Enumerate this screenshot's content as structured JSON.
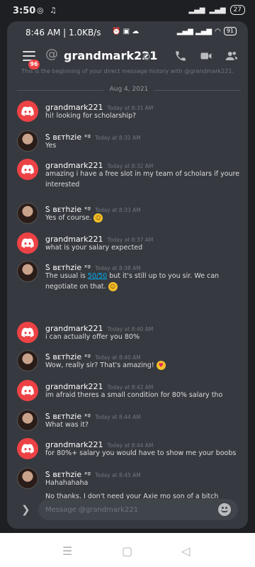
{
  "outer_status": {
    "time": "3:50",
    "battery": "27"
  },
  "inner_status": {
    "time": "8:46 AM | 1.0KB/s",
    "battery": "91"
  },
  "header": {
    "title": "grandmark221",
    "badge": "96",
    "at_symbol": "@"
  },
  "channel": {
    "beginning_text": "This is the beginning of your direct message history with @grandmark221.",
    "date_separator": "Aug 4, 2021"
  },
  "messages": [
    {
      "author": "grandmark221",
      "timestamp": "Today at 8:31 AM",
      "text": "hi! looking for scholarship?",
      "avatar": "discord"
    },
    {
      "author": "Ꮪ ʙᴇᴛhzie ˣᵍ",
      "timestamp": "Today at 8:31 AM",
      "text": "Yes",
      "avatar": "photo"
    },
    {
      "author": "grandmark221",
      "timestamp": "Today at 8:32 AM",
      "text": "amazing i have a free slot in my team of scholars if youre interested",
      "avatar": "discord"
    },
    {
      "author": "Ꮪ ʙᴇᴛhzie ˣᵍ",
      "timestamp": "Today at 8:33 AM",
      "text": "Yes of course.",
      "avatar": "photo"
    },
    {
      "author": "grandmark221",
      "timestamp": "Today at 8:37 AM",
      "text": "what is your salary expected",
      "avatar": "discord"
    },
    {
      "author": "Ꮪ ʙᴇᴛhzie ˣᵍ",
      "timestamp": "Today at 8:38 AM",
      "text_before": "The usual is ",
      "link": "50/50",
      "text_after": " but it's still up to you sir. We can negotiate on that.",
      "avatar": "photo"
    },
    {
      "author": "grandmark221",
      "timestamp": "Today at 8:40 AM",
      "text": "i can actually offer you 80%",
      "avatar": "discord"
    },
    {
      "author": "Ꮪ ʙᴇᴛhzie ˣᵍ",
      "timestamp": "Today at 8:40 AM",
      "text": "Wow, really sir? That's amazing!",
      "avatar": "photo"
    },
    {
      "author": "grandmark221",
      "timestamp": "Today at 8:42 AM",
      "text": "im afraid theres a small condition for 80% salary tho",
      "avatar": "discord"
    },
    {
      "author": "Ꮪ ʙᴇᴛhzie ˣᵍ",
      "timestamp": "Today at 8:44 AM",
      "text": "What was it?",
      "avatar": "photo"
    },
    {
      "author": "grandmark221",
      "timestamp": "Today at 8:44 AM",
      "text": "for 80%+ salary you would have to show me your boobs",
      "avatar": "discord"
    },
    {
      "author": "Ꮪ ʙᴇᴛhzie ˣᵍ",
      "timestamp": "Today at 8:45 AM",
      "text": "Hahahahaha",
      "text2": "No thanks. I don't need your Axie mo son of a bitch",
      "avatar": "photo"
    }
  ],
  "composer": {
    "placeholder": "Message @grandmark221"
  },
  "colors": {
    "discord_red": "#ed4245",
    "background": "#36393f",
    "link": "#00aff4"
  },
  "icons": [
    "menu-icon",
    "call-icon",
    "video-icon",
    "members-icon",
    "emoji-icon",
    "chevron-right-icon",
    "discord-logo-icon"
  ]
}
